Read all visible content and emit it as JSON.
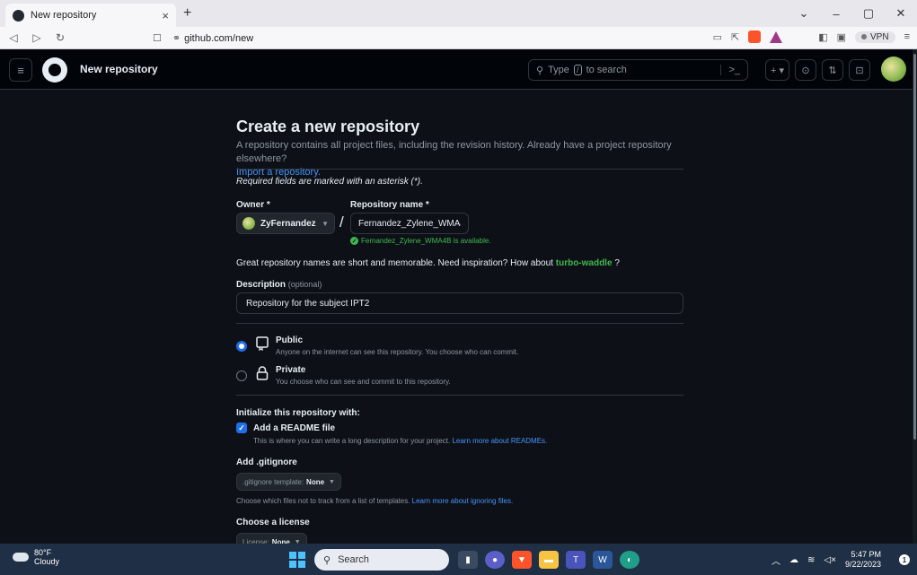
{
  "browser": {
    "tab_title": "New repository",
    "tab_close": "×",
    "new_tab": "+",
    "url": "github.com/new",
    "vpn_label": "VPN"
  },
  "header": {
    "title": "New repository",
    "search_prefix": "Type",
    "search_key": "/",
    "search_suffix": "to search"
  },
  "form": {
    "page_title": "Create a new repository",
    "subtitle": "A repository contains all project files, including the revision history. Already have a project repository elsewhere?",
    "import_link": "Import a repository.",
    "required_note": "Required fields are marked with an asterisk (*).",
    "owner_label": "Owner *",
    "owner_value": "ZyFernandez",
    "repo_label": "Repository name *",
    "repo_value": "Fernandez_Zylene_WMA4B",
    "available_msg": "Fernandez_Zylene_WMA4B is available.",
    "suggest_text": "Great repository names are short and memorable. Need inspiration? How about",
    "suggest_name": "turbo-waddle",
    "suggest_end": "?",
    "desc_label": "Description",
    "desc_optional": "(optional)",
    "desc_value": "Repository for the subject IPT2",
    "public_title": "Public",
    "public_desc": "Anyone on the internet can see this repository. You choose who can commit.",
    "private_title": "Private",
    "private_desc": "You choose who can see and commit to this repository.",
    "visibility_selected": "Public",
    "init_title": "Initialize this repository with:",
    "readme_label": "Add a README file",
    "readme_checked": true,
    "readme_desc": "This is where you can write a long description for your project.",
    "readme_link": "Learn more about READMEs.",
    "gitignore_title": "Add .gitignore",
    "gitignore_prefix": ".gitignore template:",
    "gitignore_value": "None",
    "gitignore_hint": "Choose which files not to track from a list of templates.",
    "gitignore_link": "Learn more about ignoring files.",
    "license_title": "Choose a license",
    "license_prefix": "License:",
    "license_value": "None"
  },
  "taskbar": {
    "temp": "80°F",
    "weather": "Cloudy",
    "search_label": "Search",
    "time": "5:47 PM",
    "date": "9/22/2023",
    "notif_count": "1"
  },
  "colors": {
    "accent": "#1f6feb",
    "success": "#3fb950",
    "link": "#4493f8",
    "bg": "#0d1117"
  }
}
